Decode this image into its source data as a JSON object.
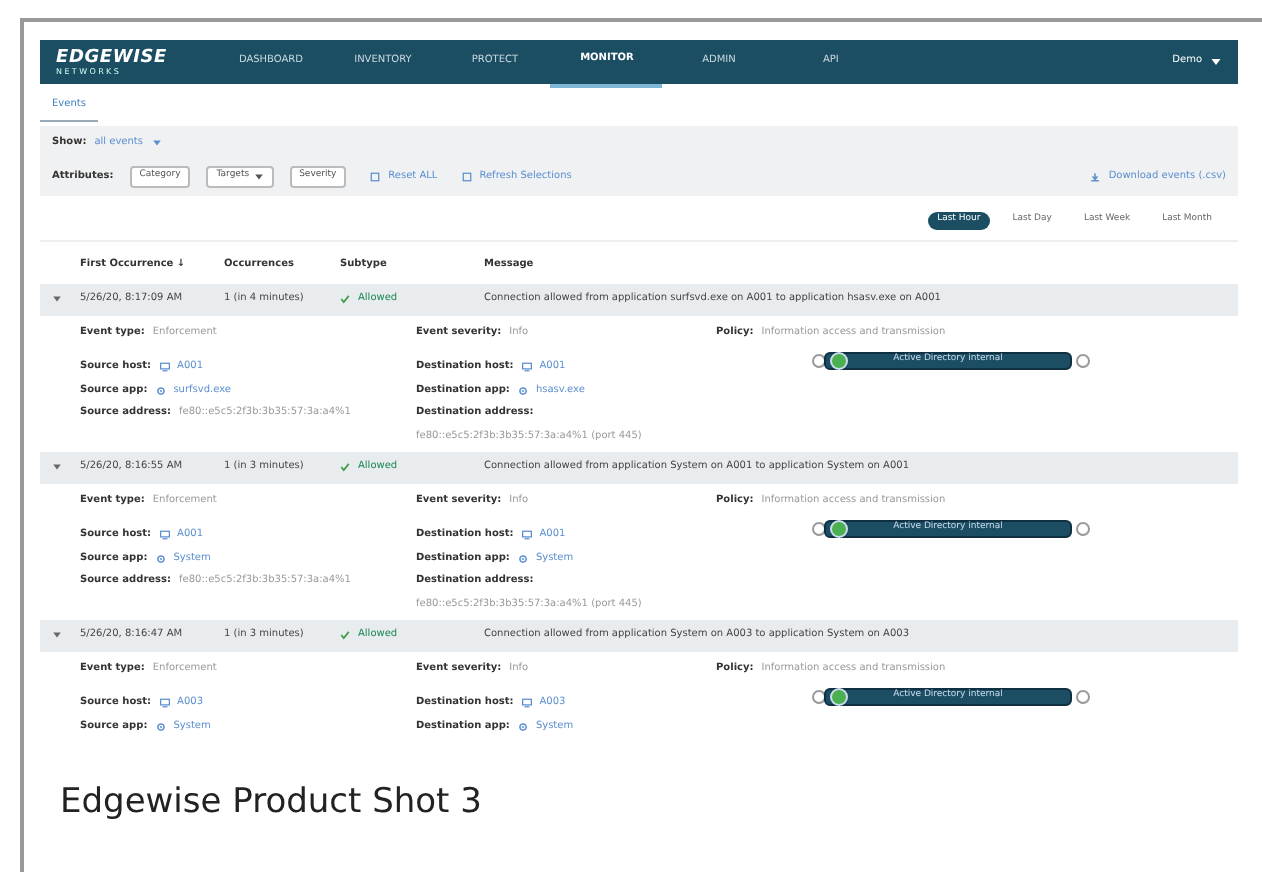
{
  "nav": {
    "logo": "EDGEWISE",
    "logo_sub": "NETWORKS",
    "items": [
      {
        "label": "DASHBOARD",
        "selected": false
      },
      {
        "label": "INVENTORY",
        "selected": false
      },
      {
        "label": "PROTECT",
        "selected": false
      },
      {
        "label": "MONITOR",
        "selected": true
      },
      {
        "label": "ADMIN",
        "selected": false
      },
      {
        "label": "API",
        "selected": false
      }
    ],
    "user": "Demo"
  },
  "breadcrumb": "Events",
  "filters": {
    "show_label": "Show:",
    "show_value": "all events",
    "attributes_label": "Attributes:",
    "attributes": [
      {
        "label": "Category",
        "dropdown": false
      },
      {
        "label": "Targets",
        "dropdown": true
      },
      {
        "label": "Severity",
        "dropdown": false
      }
    ],
    "actions": [
      "Reset ALL",
      "Refresh Selections"
    ],
    "download": "Download events (.csv)"
  },
  "time_ranges": [
    {
      "label": "Last Hour",
      "selected": true
    },
    {
      "label": "Last Day",
      "selected": false
    },
    {
      "label": "Last Week",
      "selected": false
    },
    {
      "label": "Last Month",
      "selected": false
    }
  ],
  "table": {
    "columns": [
      "First Occurrence ↓",
      "Occurrences",
      "Subtype",
      "Message"
    ],
    "rows": [
      {
        "expanded": true,
        "time": "5/26/20, 8:17:09 AM",
        "occurrences": "1 (in 4 minutes)",
        "subtype": "Allowed",
        "message": "Connection allowed from application surfsvd.exe on A001 to application hsasv.exe on A001",
        "summary": [
          {
            "label": "Event type:",
            "value": "Enforcement"
          },
          {
            "label": "Event severity:",
            "value": "Info"
          },
          {
            "label": "Policy:",
            "value": "Information access and transmission"
          }
        ],
        "source": [
          {
            "kind": "host",
            "label": "Source host:",
            "value": "A001"
          },
          {
            "kind": "app",
            "label": "Source app:",
            "value": "surfsvd.exe"
          },
          {
            "kind": "address",
            "label": "Source address:",
            "value": "fe80::e5c5:2f3b:3b35:57:3a:a4%1"
          }
        ],
        "destination": [
          {
            "kind": "host",
            "label": "Destination host:",
            "value": "A001"
          },
          {
            "kind": "app",
            "label": "Destination app:",
            "value": "hsasv.exe"
          },
          {
            "kind": "address_block",
            "label": "Destination address:",
            "value": "fe80::e5c5:2f3b:3b35:57:3a:a4%1 (port 445)"
          }
        ],
        "flow_label": "Active Directory internal"
      },
      {
        "expanded": true,
        "time": "5/26/20, 8:16:55 AM",
        "occurrences": "1 (in 3 minutes)",
        "subtype": "Allowed",
        "message": "Connection allowed from application System on A001 to application System on A001",
        "summary": [
          {
            "label": "Event type:",
            "value": "Enforcement"
          },
          {
            "label": "Event severity:",
            "value": "Info"
          },
          {
            "label": "Policy:",
            "value": "Information access and transmission"
          }
        ],
        "source": [
          {
            "kind": "host",
            "label": "Source host:",
            "value": "A001"
          },
          {
            "kind": "app",
            "label": "Source app:",
            "value": "System"
          },
          {
            "kind": "address",
            "label": "Source address:",
            "value": "fe80::e5c5:2f3b:3b35:57:3a:a4%1"
          }
        ],
        "destination": [
          {
            "kind": "host",
            "label": "Destination host:",
            "value": "A001"
          },
          {
            "kind": "app",
            "label": "Destination app:",
            "value": "System"
          },
          {
            "kind": "address_block",
            "label": "Destination address:",
            "value": "fe80::e5c5:2f3b:3b35:57:3a:a4%1 (port 445)"
          }
        ],
        "flow_label": "Active Directory internal"
      },
      {
        "expanded": true,
        "time": "5/26/20, 8:16:47 AM",
        "occurrences": "1 (in 3 minutes)",
        "subtype": "Allowed",
        "message": "Connection allowed from application System on A003 to application System on A003",
        "summary": [
          {
            "label": "Event type:",
            "value": "Enforcement"
          },
          {
            "label": "Event severity:",
            "value": "Info"
          },
          {
            "label": "Policy:",
            "value": "Information access and transmission"
          }
        ],
        "source": [
          {
            "kind": "host",
            "label": "Source host:",
            "value": "A003"
          },
          {
            "kind": "app",
            "label": "Source app:",
            "value": "System"
          }
        ],
        "destination": [
          {
            "kind": "host",
            "label": "Destination host:",
            "value": "A003"
          },
          {
            "kind": "app",
            "label": "Destination app:",
            "value": "System"
          }
        ],
        "flow_label": "Active Directory internal"
      }
    ]
  },
  "caption": "Edgewise Product Shot 3"
}
